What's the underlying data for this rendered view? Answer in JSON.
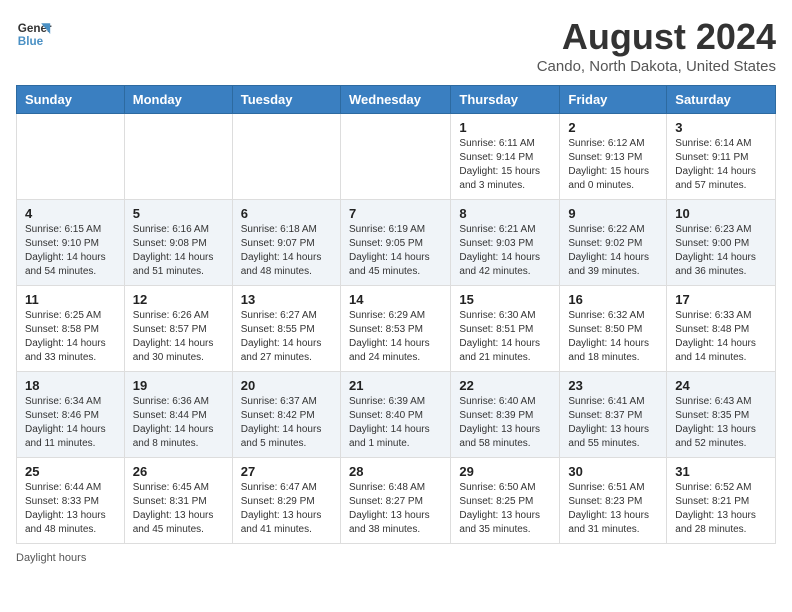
{
  "header": {
    "logo_line1": "General",
    "logo_line2": "Blue",
    "month_year": "August 2024",
    "location": "Cando, North Dakota, United States"
  },
  "days_of_week": [
    "Sunday",
    "Monday",
    "Tuesday",
    "Wednesday",
    "Thursday",
    "Friday",
    "Saturday"
  ],
  "weeks": [
    [
      {
        "day": "",
        "info": ""
      },
      {
        "day": "",
        "info": ""
      },
      {
        "day": "",
        "info": ""
      },
      {
        "day": "",
        "info": ""
      },
      {
        "day": "1",
        "info": "Sunrise: 6:11 AM\nSunset: 9:14 PM\nDaylight: 15 hours\nand 3 minutes."
      },
      {
        "day": "2",
        "info": "Sunrise: 6:12 AM\nSunset: 9:13 PM\nDaylight: 15 hours\nand 0 minutes."
      },
      {
        "day": "3",
        "info": "Sunrise: 6:14 AM\nSunset: 9:11 PM\nDaylight: 14 hours\nand 57 minutes."
      }
    ],
    [
      {
        "day": "4",
        "info": "Sunrise: 6:15 AM\nSunset: 9:10 PM\nDaylight: 14 hours\nand 54 minutes."
      },
      {
        "day": "5",
        "info": "Sunrise: 6:16 AM\nSunset: 9:08 PM\nDaylight: 14 hours\nand 51 minutes."
      },
      {
        "day": "6",
        "info": "Sunrise: 6:18 AM\nSunset: 9:07 PM\nDaylight: 14 hours\nand 48 minutes."
      },
      {
        "day": "7",
        "info": "Sunrise: 6:19 AM\nSunset: 9:05 PM\nDaylight: 14 hours\nand 45 minutes."
      },
      {
        "day": "8",
        "info": "Sunrise: 6:21 AM\nSunset: 9:03 PM\nDaylight: 14 hours\nand 42 minutes."
      },
      {
        "day": "9",
        "info": "Sunrise: 6:22 AM\nSunset: 9:02 PM\nDaylight: 14 hours\nand 39 minutes."
      },
      {
        "day": "10",
        "info": "Sunrise: 6:23 AM\nSunset: 9:00 PM\nDaylight: 14 hours\nand 36 minutes."
      }
    ],
    [
      {
        "day": "11",
        "info": "Sunrise: 6:25 AM\nSunset: 8:58 PM\nDaylight: 14 hours\nand 33 minutes."
      },
      {
        "day": "12",
        "info": "Sunrise: 6:26 AM\nSunset: 8:57 PM\nDaylight: 14 hours\nand 30 minutes."
      },
      {
        "day": "13",
        "info": "Sunrise: 6:27 AM\nSunset: 8:55 PM\nDaylight: 14 hours\nand 27 minutes."
      },
      {
        "day": "14",
        "info": "Sunrise: 6:29 AM\nSunset: 8:53 PM\nDaylight: 14 hours\nand 24 minutes."
      },
      {
        "day": "15",
        "info": "Sunrise: 6:30 AM\nSunset: 8:51 PM\nDaylight: 14 hours\nand 21 minutes."
      },
      {
        "day": "16",
        "info": "Sunrise: 6:32 AM\nSunset: 8:50 PM\nDaylight: 14 hours\nand 18 minutes."
      },
      {
        "day": "17",
        "info": "Sunrise: 6:33 AM\nSunset: 8:48 PM\nDaylight: 14 hours\nand 14 minutes."
      }
    ],
    [
      {
        "day": "18",
        "info": "Sunrise: 6:34 AM\nSunset: 8:46 PM\nDaylight: 14 hours\nand 11 minutes."
      },
      {
        "day": "19",
        "info": "Sunrise: 6:36 AM\nSunset: 8:44 PM\nDaylight: 14 hours\nand 8 minutes."
      },
      {
        "day": "20",
        "info": "Sunrise: 6:37 AM\nSunset: 8:42 PM\nDaylight: 14 hours\nand 5 minutes."
      },
      {
        "day": "21",
        "info": "Sunrise: 6:39 AM\nSunset: 8:40 PM\nDaylight: 14 hours\nand 1 minute."
      },
      {
        "day": "22",
        "info": "Sunrise: 6:40 AM\nSunset: 8:39 PM\nDaylight: 13 hours\nand 58 minutes."
      },
      {
        "day": "23",
        "info": "Sunrise: 6:41 AM\nSunset: 8:37 PM\nDaylight: 13 hours\nand 55 minutes."
      },
      {
        "day": "24",
        "info": "Sunrise: 6:43 AM\nSunset: 8:35 PM\nDaylight: 13 hours\nand 52 minutes."
      }
    ],
    [
      {
        "day": "25",
        "info": "Sunrise: 6:44 AM\nSunset: 8:33 PM\nDaylight: 13 hours\nand 48 minutes."
      },
      {
        "day": "26",
        "info": "Sunrise: 6:45 AM\nSunset: 8:31 PM\nDaylight: 13 hours\nand 45 minutes."
      },
      {
        "day": "27",
        "info": "Sunrise: 6:47 AM\nSunset: 8:29 PM\nDaylight: 13 hours\nand 41 minutes."
      },
      {
        "day": "28",
        "info": "Sunrise: 6:48 AM\nSunset: 8:27 PM\nDaylight: 13 hours\nand 38 minutes."
      },
      {
        "day": "29",
        "info": "Sunrise: 6:50 AM\nSunset: 8:25 PM\nDaylight: 13 hours\nand 35 minutes."
      },
      {
        "day": "30",
        "info": "Sunrise: 6:51 AM\nSunset: 8:23 PM\nDaylight: 13 hours\nand 31 minutes."
      },
      {
        "day": "31",
        "info": "Sunrise: 6:52 AM\nSunset: 8:21 PM\nDaylight: 13 hours\nand 28 minutes."
      }
    ]
  ],
  "footer": {
    "note": "Daylight hours"
  }
}
